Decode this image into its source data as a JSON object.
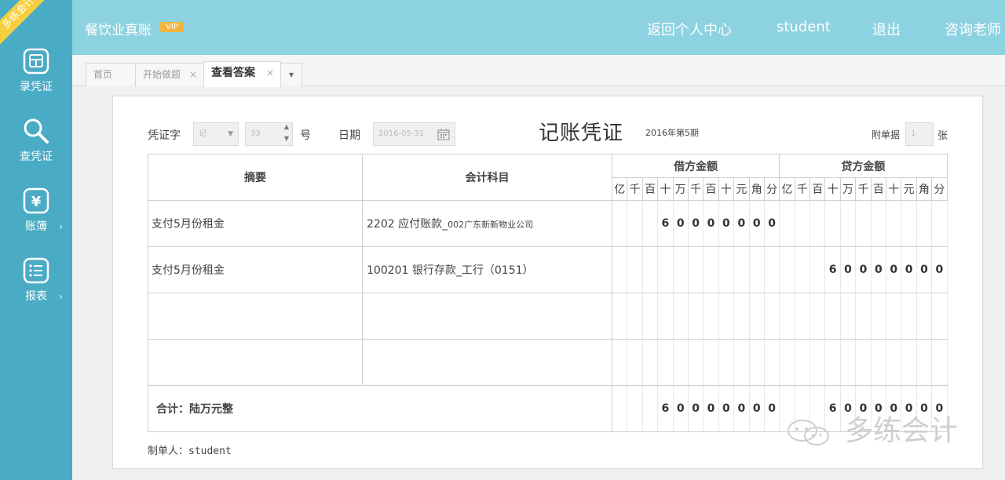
{
  "brand": {
    "ribbon": "多练会计",
    "title": "餐饮业真账",
    "vip": "VIP"
  },
  "sidebar": {
    "items": [
      {
        "label": "录凭证",
        "icon": "voucher-entry-icon"
      },
      {
        "label": "查凭证",
        "icon": "search-icon"
      },
      {
        "label": "账簿",
        "icon": "yen-icon",
        "arrow": "›"
      },
      {
        "label": "报表",
        "icon": "report-list-icon",
        "arrow": "›"
      }
    ]
  },
  "header": {
    "links": [
      "返回个人中心",
      "student",
      "退出",
      "咨询老师"
    ]
  },
  "tabs": [
    {
      "label": "首页",
      "closable": false
    },
    {
      "label": "开始做题",
      "closable": true
    },
    {
      "label": "查看答案",
      "closable": true,
      "active": true
    }
  ],
  "tab_close": "×",
  "tab_more": "▾",
  "voucher": {
    "word_label": "凭证字",
    "word_value": "记",
    "number_value": "33",
    "number_label": "号",
    "date_label": "日期",
    "date_value": "2016-05-31",
    "title": "记账凭证",
    "period": "2016年第5期",
    "attachment_label": "附单据",
    "attachment_value": "1",
    "attachment_unit": "张",
    "headers": {
      "summary": "摘要",
      "account": "会计科目",
      "debit": "借方金额",
      "credit": "贷方金额"
    },
    "units": [
      "亿",
      "千",
      "百",
      "十",
      "万",
      "千",
      "百",
      "十",
      "元",
      "角",
      "分"
    ],
    "rows": [
      {
        "summary": "支付5月份租金",
        "account_code": "2202",
        "account_name": "应付账款_",
        "account_sub": "002广东新新物业公司",
        "debit": "600000.00",
        "credit": ""
      },
      {
        "summary": "支付5月份租金",
        "account_code": "100201",
        "account_name": "银行存款_工行（0151）",
        "account_sub": "",
        "debit": "",
        "credit": "600000.00"
      },
      {
        "summary": "",
        "account_code": "",
        "account_name": "",
        "account_sub": "",
        "debit": "",
        "credit": ""
      },
      {
        "summary": "",
        "account_code": "",
        "account_name": "",
        "account_sub": "",
        "debit": "",
        "credit": ""
      }
    ],
    "total_label": "合计：陆万元整",
    "total_debit": "600000.00",
    "total_credit": "600000.00",
    "maker": "制单人：student"
  },
  "watermark": {
    "text": "多练会计"
  }
}
